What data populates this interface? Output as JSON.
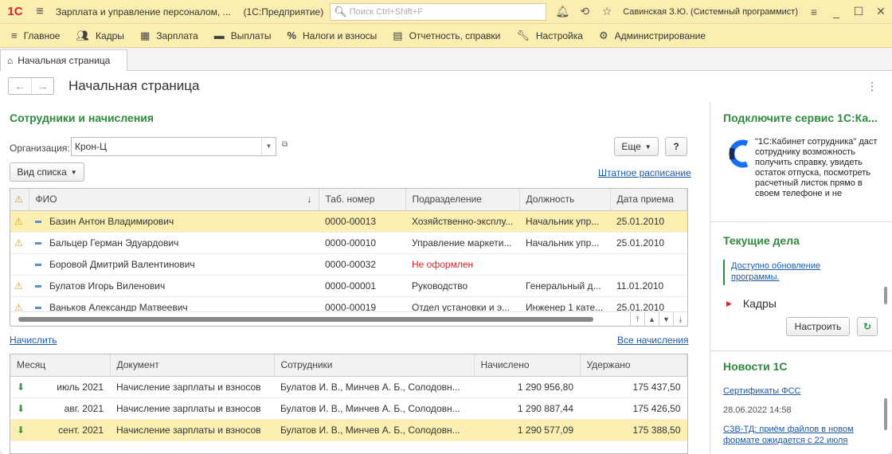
{
  "app": {
    "logo": "1С",
    "title": "Зарплата и управление персоналом, ...",
    "platform": "(1С:Предприятие)",
    "search_placeholder": "Поиск Ctrl+Shift+F",
    "user": "Савинская З.Ю. (Системный программист)"
  },
  "menu": [
    {
      "label": "Главное",
      "icon": "hamburger-icon"
    },
    {
      "label": "Кадры",
      "icon": "people-icon"
    },
    {
      "label": "Зарплата",
      "icon": "calculator-icon"
    },
    {
      "label": "Выплаты",
      "icon": "wallet-icon"
    },
    {
      "label": "Налоги и взносы",
      "icon": "percent-icon"
    },
    {
      "label": "Отчетность, справки",
      "icon": "report-icon"
    },
    {
      "label": "Настройка",
      "icon": "wrench-icon"
    },
    {
      "label": "Администрирование",
      "icon": "gear-icon"
    }
  ],
  "tab": {
    "label": "Начальная страница"
  },
  "page": {
    "title": "Начальная страница"
  },
  "employees": {
    "title": "Сотрудники и начисления",
    "org_label": "Организация:",
    "org_value": "Крон-Ц",
    "more_btn": "Еще",
    "help_btn": "?",
    "view_btn": "Вид списка",
    "staff_link": "Штатное расписание",
    "columns": [
      "ФИО",
      "Таб. номер",
      "Подразделение",
      "Должность",
      "Дата приема"
    ],
    "rows": [
      {
        "warn": true,
        "name": "Базин Антон Владимирович",
        "tab": "0000-00013",
        "dept": "Хозяйственно-эксплу...",
        "pos": "Начальник упр...",
        "date": "25.01.2010",
        "selected": true
      },
      {
        "warn": true,
        "name": "Бальцер Герман Эдуардович",
        "tab": "0000-00010",
        "dept": "Управление маркети...",
        "pos": "Начальник упр...",
        "date": "25.01.2010"
      },
      {
        "warn": false,
        "name": "Боровой Дмитрий Валентинович",
        "tab": "0000-00032",
        "dept": "Не оформлен",
        "pos": "",
        "date": "",
        "dept_red": true
      },
      {
        "warn": true,
        "name": "Булатов Игорь Виленович",
        "tab": "0000-00001",
        "dept": "Руководство",
        "pos": "Генеральный д...",
        "date": "11.01.2010"
      },
      {
        "warn": true,
        "name": "Ваньков Александр Матвеевич",
        "tab": "0000-00019",
        "dept": "Отдел установки и э...",
        "pos": "Инженер 1 кате...",
        "date": "25.01.2010"
      }
    ]
  },
  "accruals": {
    "accrue_link": "Начислить",
    "all_link": "Все начисления",
    "columns": [
      "Месяц",
      "Документ",
      "Сотрудники",
      "Начислено",
      "Удержано"
    ],
    "rows": [
      {
        "month": "июль 2021",
        "doc": "Начисление зарплаты и взносов",
        "emps": "Булатов И. В., Минчев А. Б., Солодовн...",
        "accrued": "1 290 956,80",
        "withheld": "175 437,50"
      },
      {
        "month": "авг. 2021",
        "doc": "Начисление зарплаты и взносов",
        "emps": "Булатов И. В., Минчев А. Б., Солодовн...",
        "accrued": "1 290 887,44",
        "withheld": "175 426,50"
      },
      {
        "month": "сент. 2021",
        "doc": "Начисление зарплаты и взносов",
        "emps": "Булатов И. В., Минчев А. Б., Солодовн...",
        "accrued": "1 290 577,09",
        "withheld": "175 388,50",
        "selected": true
      }
    ]
  },
  "right": {
    "service_title": "Подключите сервис 1С:Ка...",
    "service_text": "\"1С:Кабинет сотрудника\" даст сотруднику возможность получить справку, увидеть остаток отпуска, посмотреть расчетный листок прямо в своем телефоне и не",
    "tasks_title": "Текущие дела",
    "update_link": "Доступно обновление программы.",
    "kadry": "Кадры",
    "configure_btn": "Настроить",
    "news_title": "Новости 1С",
    "news": [
      {
        "title": "Сертификаты ФСС",
        "date": "28.06.2022 14:58"
      },
      {
        "title": "СЗВ-ТД: приём файлов в новом формате ожидается с 22 июля",
        "date": ""
      }
    ]
  }
}
